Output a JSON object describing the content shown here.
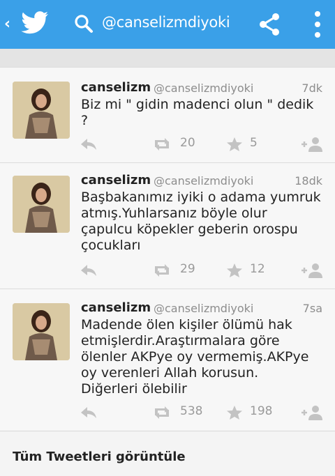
{
  "header": {
    "back_glyph": "‹",
    "search_query": "@canselizmdiyoki",
    "icons": [
      "back-icon",
      "twitter-bird-icon",
      "search-icon",
      "share-icon",
      "more-icon"
    ],
    "background_color": "#3aa0e8"
  },
  "tweets": [
    {
      "name": "canselizm",
      "username": "@canselizmdiyoki",
      "time": "7dk",
      "text_lines": [
        "Biz mi \" gidin madenci olun \" dedik",
        "?"
      ],
      "retweets": "20",
      "favorites": "5"
    },
    {
      "name": "canselizm",
      "username": "@canselizmdiyoki",
      "time": "18dk",
      "text_lines": [
        "Başbakanımız iyiki o adama yumruk",
        "atmış.Yuhlarsanız böyle olur",
        "çapulcu köpekler geberin orospu",
        "çocukları"
      ],
      "retweets": "29",
      "favorites": "12"
    },
    {
      "name": "canselizm",
      "username": "@canselizmdiyoki",
      "time": "7sa",
      "text_lines": [
        "Madende ölen kişiler ölümü hak",
        "etmişlerdir.Araştırmalara göre",
        "ölenler AKPye oy vermemiş.AKPye",
        "oy verenleri Allah korusun.",
        "Diğerleri ölebilir"
      ],
      "retweets": "538",
      "favorites": "198"
    }
  ],
  "footer": {
    "view_all_label": "Tüm Tweetleri görüntüle"
  }
}
